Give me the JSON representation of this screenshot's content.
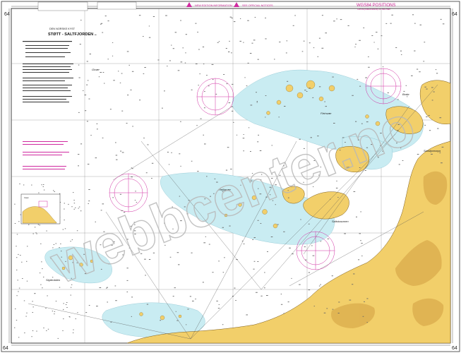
{
  "chart": {
    "number": "64",
    "header_title": "DEN NORSKE KYST",
    "title": "STØTT - SALTFJORDEN",
    "wgs_title": "WGS84 POSITIONS",
    "wgs_note": "Can be plotted directly on this chart",
    "magenta_notices": [
      "NEW EDITION INFORMATION",
      "SEE OFFICIAL NOTICES"
    ],
    "place_names": [
      "Fleinvær",
      "Givær",
      "Helligvær",
      "Bodø",
      "Saltstraumen",
      "Fleinvær",
      "Sandhornøya",
      "Skjærdalen"
    ],
    "watermark": "webbcenter.no",
    "inset_label": "Inset"
  },
  "colors": {
    "sea": "#ffffff",
    "shallow": "#c9ecf2",
    "land": "#f2cf6a",
    "land_dark": "#d9a94a",
    "magenta": "#d02aa0",
    "watermark": "#bfbfbf"
  }
}
